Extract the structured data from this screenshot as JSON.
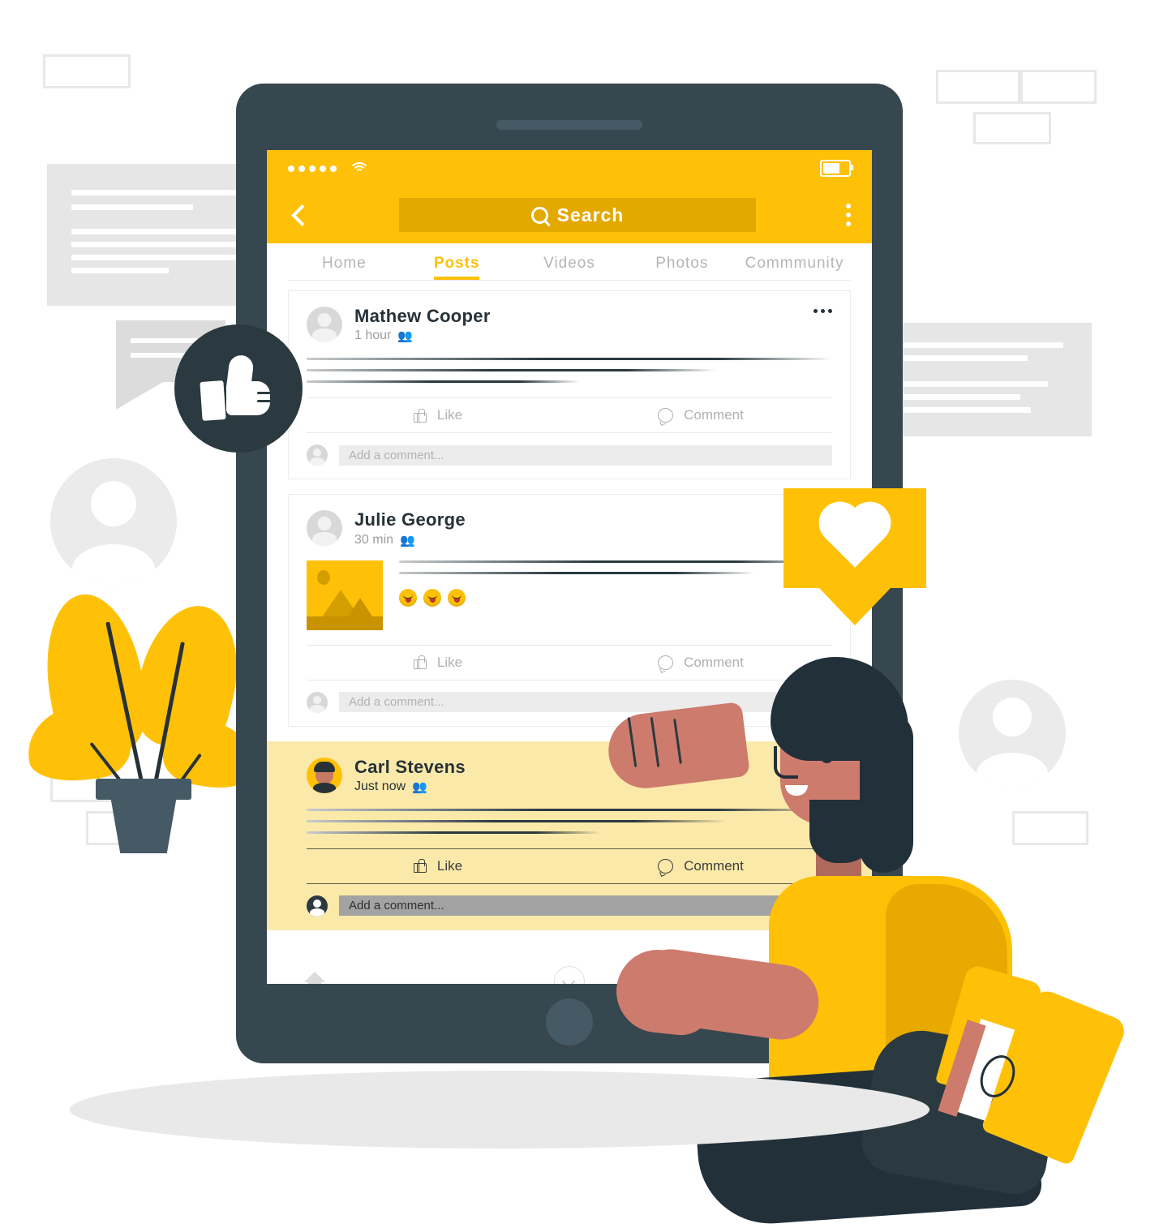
{
  "status_bar": {
    "signal_dots": 5,
    "wifi_icon": "wifi-icon",
    "battery_icon": "battery-icon"
  },
  "app_bar": {
    "back_icon": "chevron-left-icon",
    "search_icon": "search-icon",
    "search_placeholder": "Search",
    "overflow_icon": "kebab-menu-icon"
  },
  "tabs": [
    {
      "label": "Home",
      "active": false
    },
    {
      "label": "Posts",
      "active": true
    },
    {
      "label": "Videos",
      "active": false
    },
    {
      "label": "Photos",
      "active": false
    },
    {
      "label": "Commmunity",
      "active": false
    }
  ],
  "posts": [
    {
      "author": "Mathew Cooper",
      "time": "1 hour",
      "audience_icon": "friends-icon",
      "more_icon": "more-options-icon",
      "like_label": "Like",
      "like_icon": "thumbs-up-icon",
      "comment_label": "Comment",
      "comment_icon": "comment-bubble-icon",
      "comment_placeholder": "Add a comment...",
      "has_media": false,
      "highlighted": false
    },
    {
      "author": "Julie George",
      "time": "30 min",
      "audience_icon": "friends-icon",
      "more_icon": "more-options-icon",
      "like_label": "Like",
      "like_icon": "thumbs-up-icon",
      "comment_label": "Comment",
      "comment_icon": "comment-bubble-icon",
      "comment_placeholder": "Add a comment...",
      "has_media": true,
      "media_icon": "image-thumbnail",
      "reactions": [
        "laughing-emoji",
        "laughing-emoji",
        "laughing-emoji"
      ],
      "highlighted": false
    },
    {
      "author": "Carl Stevens",
      "time": "Just now",
      "audience_icon": "friends-icon",
      "more_icon": "more-options-icon",
      "like_label": "Like",
      "like_icon": "thumbs-up-icon",
      "comment_label": "Comment",
      "comment_icon": "comment-bubble-icon",
      "comment_placeholder": "Add a comment...",
      "has_media": false,
      "highlighted": true
    }
  ],
  "bottom_nav": {
    "home_icon": "home-icon",
    "collapse_icon": "chevron-down-circle-icon"
  },
  "floating_badges": [
    {
      "name": "like-badge",
      "icon": "thumbs-up-icon",
      "background": "#2b3a40",
      "foreground": "#ffffff"
    },
    {
      "name": "heart-badge",
      "icon": "heart-icon",
      "background": "#ffc107",
      "foreground": "#ffffff"
    }
  ],
  "decor": {
    "plant": "potted-plant-illustration",
    "person": "seated-man-illustration",
    "placeholder_avatars": 2,
    "placeholder_cards": 2,
    "outline_rectangles": 7,
    "speech_bubble": "speech-bubble-placeholder"
  },
  "colors": {
    "accent_yellow": "#ffc107",
    "search_field": "#e3a900",
    "dark_slate": "#37474f",
    "badge_dark": "#2b3a40",
    "highlight_card": "#fbe9a9",
    "skin": "#c77a63",
    "muted_text": "#b0b0b0",
    "placeholder_gray": "#e6e6e6"
  }
}
